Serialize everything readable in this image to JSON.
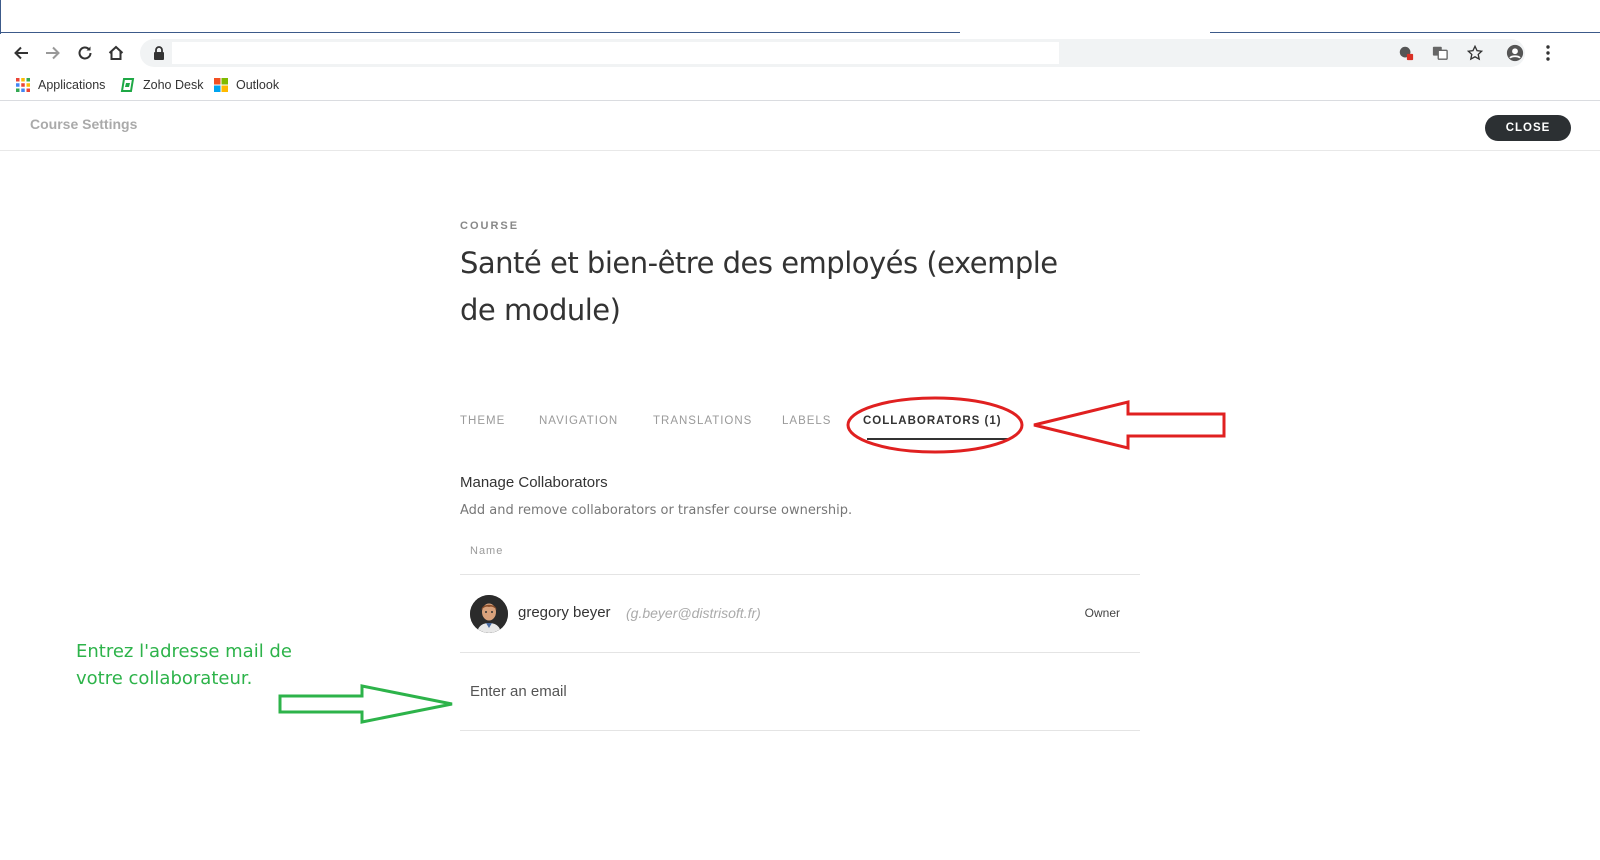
{
  "browser": {
    "bookmarks": [
      {
        "label": "Applications",
        "icon": "apps-grid-icon"
      },
      {
        "label": "Zoho Desk",
        "icon": "zoho-desk-icon"
      },
      {
        "label": "Outlook",
        "icon": "windows-logo-icon"
      }
    ]
  },
  "header": {
    "title": "Course Settings",
    "close_label": "CLOSE"
  },
  "course": {
    "eyebrow": "COURSE",
    "title": "Santé et bien-être des employés (exemple de module)"
  },
  "tabs": [
    {
      "label": "THEME",
      "active": false
    },
    {
      "label": "NAVIGATION",
      "active": false
    },
    {
      "label": "TRANSLATIONS",
      "active": false
    },
    {
      "label": "LABELS",
      "active": false
    },
    {
      "label": "COLLABORATORS (1)",
      "active": true
    }
  ],
  "collaborators": {
    "heading": "Manage Collaborators",
    "subheading": "Add and remove collaborators or transfer course ownership.",
    "column_name": "Name",
    "items": [
      {
        "name": "gregory beyer",
        "email": "(g.beyer@distrisoft.fr)",
        "role": "Owner"
      }
    ],
    "email_placeholder": "Enter an email"
  },
  "annotation": {
    "text": "Entrez l'adresse mail de votre collaborateur.",
    "red_color": "#e02020",
    "green_color": "#2db34a"
  }
}
